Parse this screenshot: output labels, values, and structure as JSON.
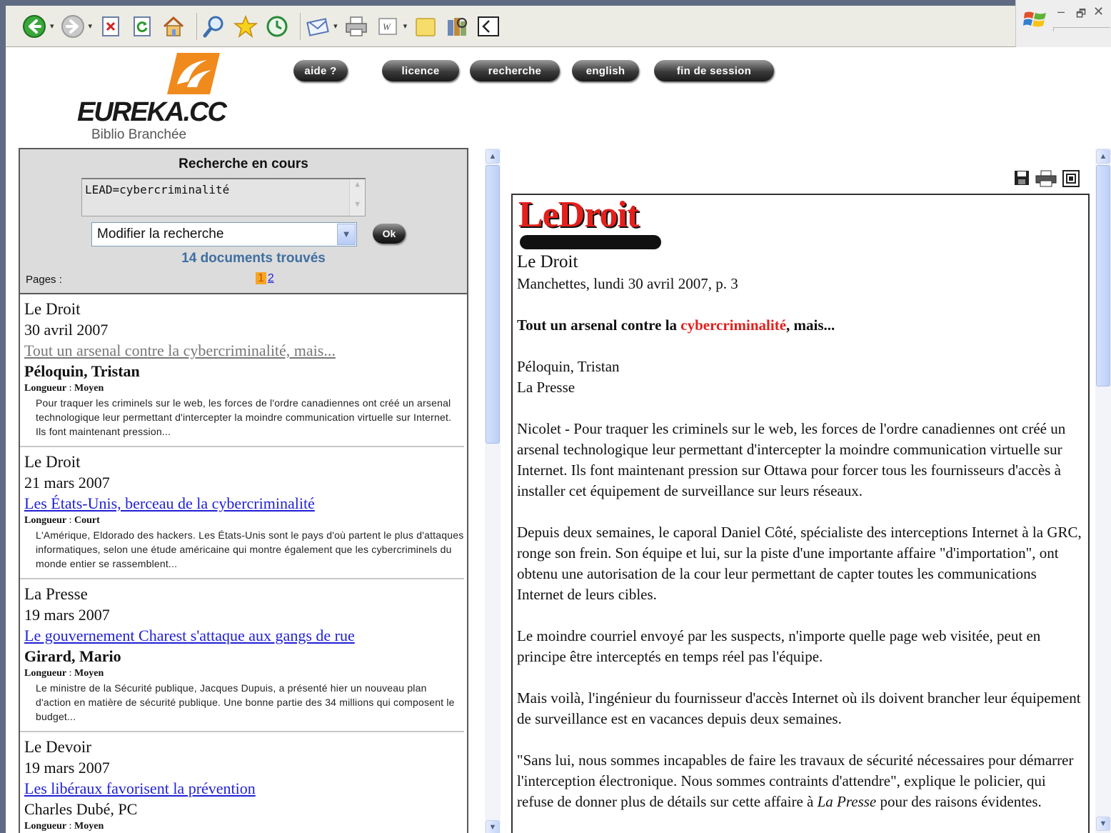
{
  "nav": {
    "aide": "aide ?",
    "licence": "licence",
    "recherche": "recherche",
    "english": "english",
    "fin_session": "fin de session"
  },
  "logo": {
    "brand": "EUREKA.CC",
    "subtitle": "Biblio Branchée"
  },
  "search": {
    "title": "Recherche en cours",
    "query": "LEAD=cybercriminalité",
    "select_value": "Modifier la recherche",
    "ok_label": "Ok",
    "count": "14 documents trouvés",
    "pages_label": "Pages :",
    "pages": [
      "1",
      "2"
    ]
  },
  "results": [
    {
      "source": "Le Droit",
      "date": "30 avril 2007",
      "title": "Tout un arsenal contre la cybercriminalité, mais...",
      "author": "Péloquin, Tristan",
      "length_label": "Longueur",
      "length": "Moyen",
      "summary": "Pour traquer les criminels sur le web, les forces de l'ordre canadiennes ont créé un arsenal technologique leur permettant d'intercepter la moindre communication virtuelle sur Internet. Ils font maintenant pression..."
    },
    {
      "source": "Le Droit",
      "date": "21 mars 2007",
      "title": "Les États-Unis, berceau de la cybercriminalité",
      "author": "",
      "length_label": "Longueur",
      "length": "Court",
      "summary": "L'Amérique, Eldorado des hackers. Les États-Unis sont le pays d'où partent le plus d'attaques informatiques, selon une étude américaine qui montre également que les cybercriminels du monde entier se rassemblent..."
    },
    {
      "source": "La Presse",
      "date": "19 mars 2007",
      "title": "Le gouvernement Charest s'attaque aux gangs de rue",
      "author": "Girard, Mario",
      "length_label": "Longueur",
      "length": "Moyen",
      "summary": "Le ministre de la Sécurité publique, Jacques Dupuis, a présenté hier un nouveau plan d'action en matière de sécurité publique. Une bonne partie des 34 millions qui composent le budget..."
    },
    {
      "source": "Le Devoir",
      "date": "19 mars 2007",
      "title": "Les libéraux favorisent la prévention",
      "author": "Charles Dubé, PC",
      "length_label": "Longueur",
      "length": "Moyen",
      "summary": ""
    }
  ],
  "article": {
    "logo_text": "LeDroit",
    "source": "Le Droit",
    "edition": "Manchettes, lundi 30 avril 2007, p. 3",
    "headline_pre": "Tout un arsenal contre la ",
    "headline_hl": "cybercriminalité",
    "headline_post": ", mais...",
    "author": "Péloquin, Tristan",
    "outlet": "La Presse",
    "p1": "Nicolet - Pour traquer les criminels sur le web, les forces de l'ordre canadiennes ont créé un arsenal technologique leur permettant d'intercepter la moindre communication virtuelle sur Internet. Ils font maintenant pression sur Ottawa pour forcer tous les fournisseurs d'accès à installer cet équipement de surveillance sur leurs réseaux.",
    "p2": "Depuis deux semaines, le caporal Daniel Côté, spécialiste des interceptions Internet à la GRC, ronge son frein. Son équipe et lui, sur la piste d'une importante affaire \"d'importation\", ont obtenu une autorisation de la cour leur permettant de capter toutes les communications Internet de leurs cibles.",
    "p3": "Le moindre courriel envoyé par les suspects, n'importe quelle page web visitée, peut en principe être interceptés en temps réel pas l'équipe.",
    "p4": "Mais voilà, l'ingénieur du fournisseur d'accès Internet où ils doivent brancher leur équipement de surveillance est en vacances depuis deux semaines.",
    "p5_pre": "\"Sans lui, nous sommes incapables de faire les travaux de sécurité nécessaires pour démarrer l'interception électronique. Nous sommes contraints d'attendre\", explique le policier, qui refuse de donner plus de détails sur cette affaire à ",
    "p5_em": "La Presse",
    "p5_post": " pour des raisons évidentes."
  },
  "icons": [
    "back-icon",
    "forward-icon",
    "stop-icon",
    "refresh-icon",
    "home-icon",
    "search-icon",
    "favorites-icon",
    "history-icon",
    "mail-icon",
    "print-icon",
    "edit-icon",
    "folder-icon",
    "research-icon",
    "source-icon",
    "windows-logo-icon",
    "save-icon",
    "printer-icon",
    "fullscreen-icon"
  ],
  "colors": {
    "accent_orange": "#f08a1c",
    "link_blue": "#1f1fd6",
    "highlight_red": "#e3201b",
    "count_blue": "#3f6fa0"
  }
}
